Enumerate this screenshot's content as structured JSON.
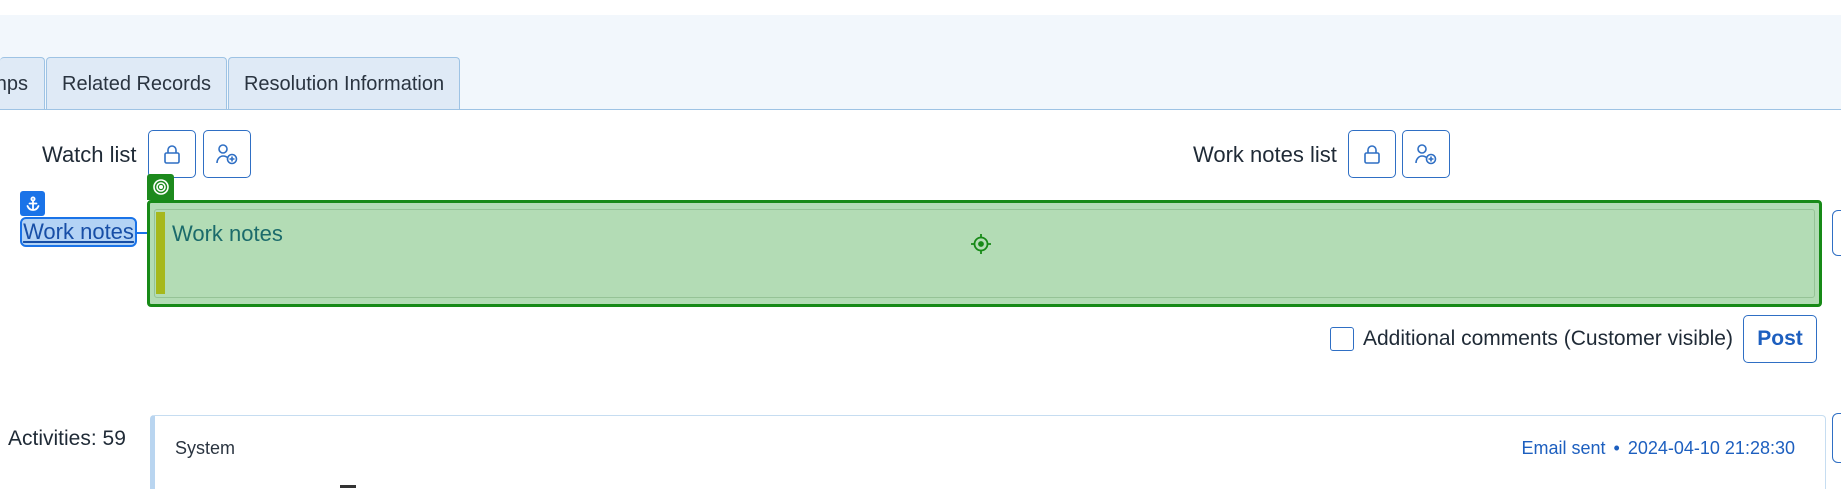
{
  "tabs": [
    {
      "label": "nps"
    },
    {
      "label": "Related Records"
    },
    {
      "label": "Resolution Information"
    }
  ],
  "watch_list": {
    "label": "Watch list"
  },
  "work_notes_list": {
    "label": "Work notes list"
  },
  "work_notes": {
    "label": "Work notes",
    "placeholder": "Work notes"
  },
  "additional_comments": {
    "label": "Additional comments (Customer visible)",
    "checked": false
  },
  "post_button": {
    "label": "Post"
  },
  "activities": {
    "label": "Activities: 59"
  },
  "activity": {
    "author": "System",
    "type": "Email sent",
    "separator": "•",
    "timestamp": "2024-04-10 21:28:30"
  },
  "icons": [
    "lock-icon",
    "add-user-icon",
    "anchor-icon",
    "target-icon",
    "crosshair-icon"
  ],
  "colors": {
    "accent": "#2f6fc4",
    "highlight_green": "#b3dcb5",
    "highlight_border": "#178a17",
    "label_highlight": "#b3d3f5",
    "tab_bg": "#dfeaf6"
  }
}
